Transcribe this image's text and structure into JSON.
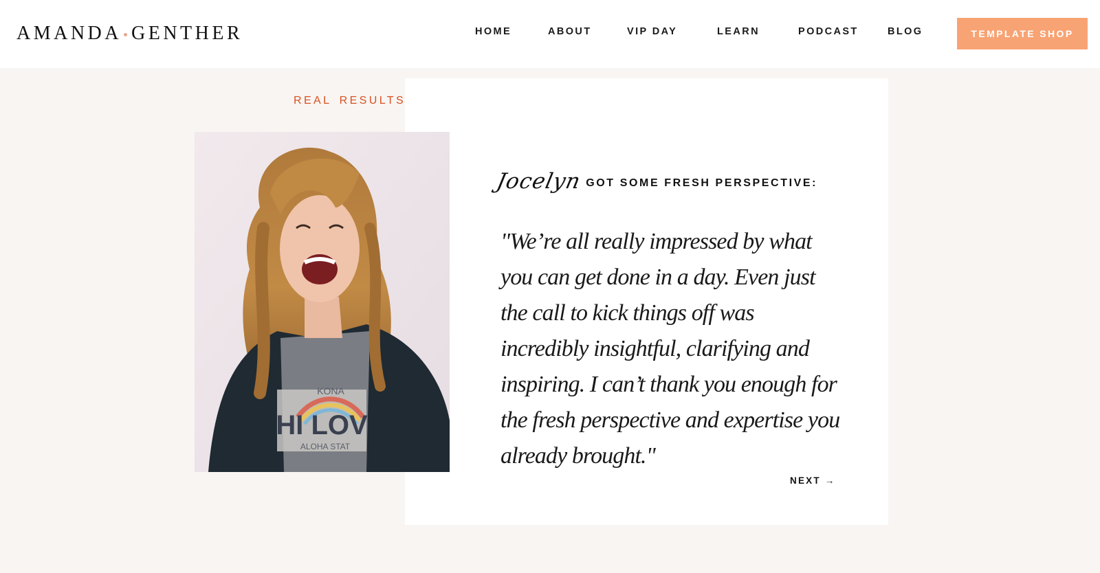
{
  "header": {
    "logo": {
      "first": "AMANDA",
      "second": "GENTHER"
    },
    "nav": {
      "home": "HOME",
      "about": "ABOUT",
      "vip_day": "VIP DAY",
      "learn": "LEARN",
      "podcast": "PODCAST",
      "blog": "BLOG"
    },
    "cta": "TEMPLATE SHOP"
  },
  "testimonial": {
    "section_label": "REAL RESULTS",
    "name": "Jocelyn",
    "heading": "GOT SOME FRESH PERSPECTIVE:",
    "quote": "\"We’re all really impressed by what you can get done in a day. Even just the call to kick things off was incredibly insightful, clarifying and inspiring. I can’t thank you enough for the fresh perspective and expertise you already brought.\"",
    "next": "NEXT →",
    "photo": {
      "shirt_line1": "KONA",
      "shirt_line2": "HI LOV",
      "shirt_line3": "ALOHA STAT"
    }
  },
  "colors": {
    "accent": "#f8a373",
    "label": "#d9501f",
    "background": "#f8f5f3",
    "logo_dot": "#e8a78b"
  }
}
